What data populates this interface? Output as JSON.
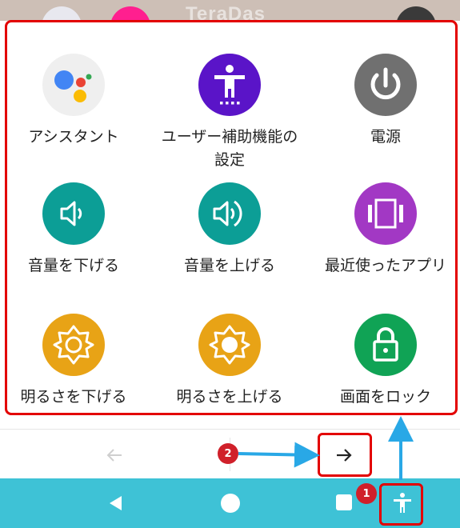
{
  "watermark": "TeraDas",
  "menu": {
    "items": [
      {
        "label": "アシスタント",
        "icon": "google-assistant-icon"
      },
      {
        "label": "ユーザー補助機能の設定",
        "icon": "accessibility-settings-icon"
      },
      {
        "label": "電源",
        "icon": "power-icon"
      },
      {
        "label": "音量を下げる",
        "icon": "volume-down-icon"
      },
      {
        "label": "音量を上げる",
        "icon": "volume-up-icon"
      },
      {
        "label": "最近使ったアプリ",
        "icon": "recent-apps-icon"
      },
      {
        "label": "明るさを下げる",
        "icon": "brightness-down-icon"
      },
      {
        "label": "明るさを上げる",
        "icon": "brightness-up-icon"
      },
      {
        "label": "画面をロック",
        "icon": "lock-icon"
      }
    ]
  },
  "pager": {
    "prev_icon": "arrow-left-icon",
    "next_icon": "arrow-right-icon"
  },
  "navbar": {
    "back_icon": "back-icon",
    "home_icon": "home-icon",
    "recents_icon": "recents-icon",
    "a11y_icon": "accessibility-icon"
  },
  "callouts": {
    "one": "1",
    "two": "2"
  },
  "colors": {
    "highlight": "#e30000",
    "navbar": "#3ec2d6",
    "accessibility_purple": "#5a14c8",
    "power_gray": "#707070",
    "volume_teal": "#0c9e96",
    "recents_purple": "#a238c4",
    "brightness_orange": "#e8a316",
    "lock_green": "#10a355",
    "badge_red": "#d0202a",
    "callout_arrow": "#29a8e6"
  }
}
